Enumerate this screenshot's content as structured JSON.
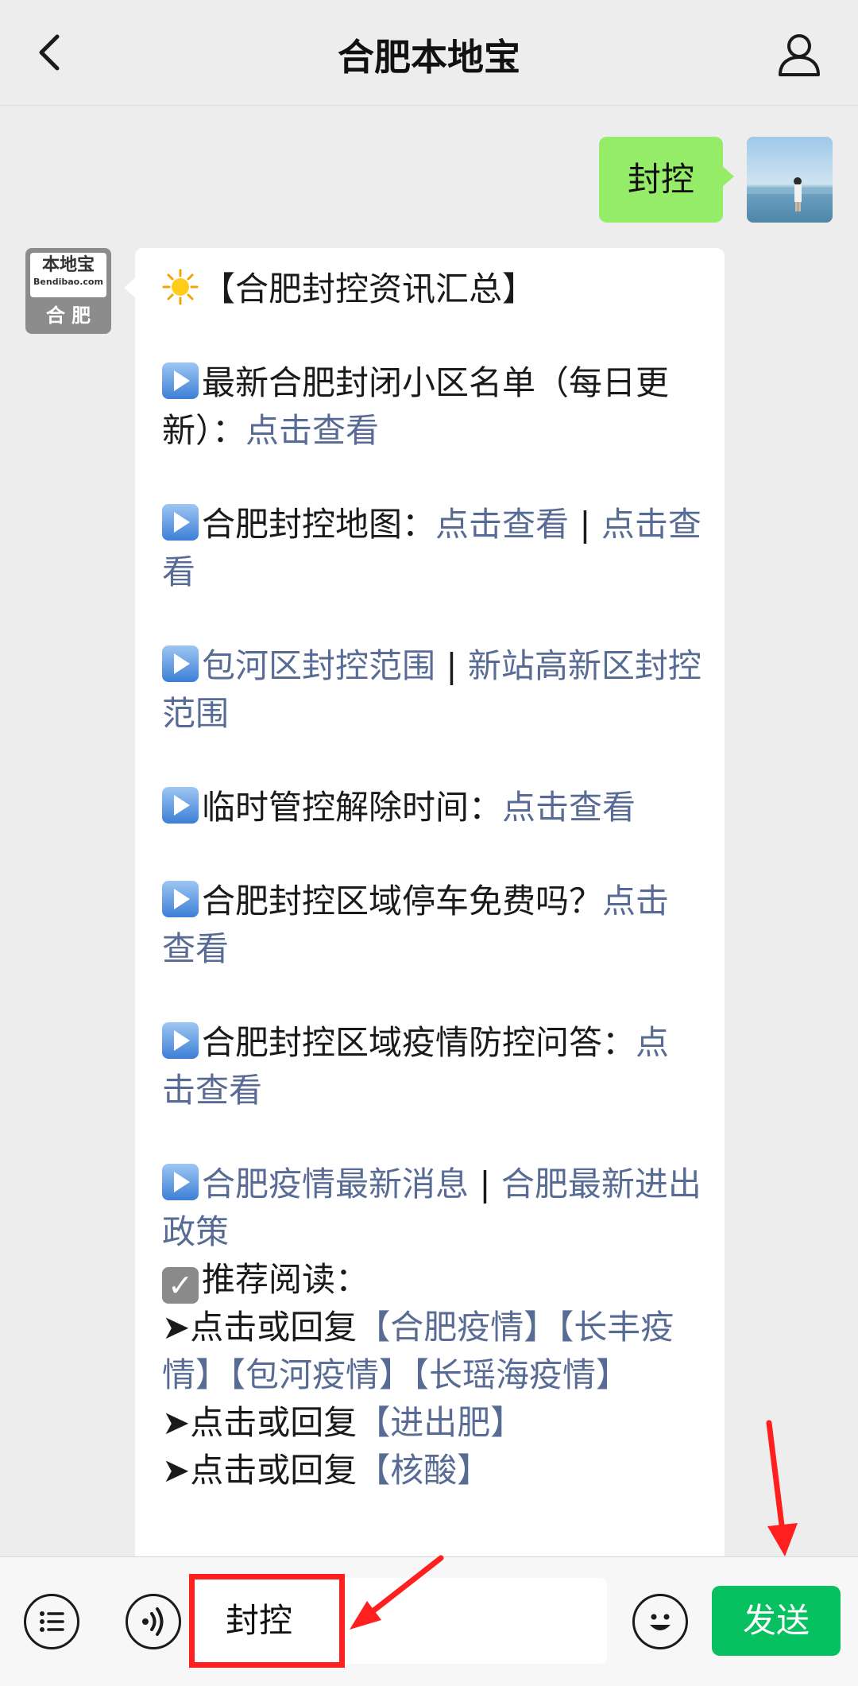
{
  "header": {
    "title": "合肥本地宝"
  },
  "sent_message": {
    "text": "封控"
  },
  "bot_avatar": {
    "brand": "本地宝",
    "url": "Bendibao.com",
    "city": "合 肥"
  },
  "message": {
    "title": "【合肥封控资讯汇总】",
    "items": [
      {
        "text": "最新合肥封闭小区名单（每日更新）：",
        "link": "点击查看"
      },
      {
        "text": "合肥封控地图：",
        "link1": "点击查看",
        "sep": " | ",
        "link2": "点击查看"
      },
      {
        "link1": "包河区封控范围",
        "sep": " | ",
        "link2": "新站高新区封控范围"
      },
      {
        "text": "临时管控解除时间：",
        "link": "点击查看"
      },
      {
        "text": "合肥封控区域停车免费吗？",
        "link": "点击查看"
      },
      {
        "text": "合肥封控区域疫情防控问答：",
        "link": "点击查看"
      },
      {
        "link1": "合肥疫情最新消息",
        "sep": " | ",
        "link2": "合肥最新进出政策"
      }
    ],
    "recommend_label": "推荐阅读：",
    "recommend": [
      {
        "prefix": "➤点击或回复",
        "links": [
          "【合肥疫情】",
          "【长丰疫情】",
          "【包河疫情】",
          "【长瑶海疫情】"
        ]
      },
      {
        "prefix": "➤点击或回复",
        "links": [
          "【进出肥】"
        ]
      },
      {
        "prefix": "➤点击或回复",
        "links": [
          "【核酸】"
        ]
      }
    ]
  },
  "input_bar": {
    "value": "封控",
    "send_label": "发送"
  },
  "colors": {
    "link": "#576b95",
    "sent_bubble": "#95ec69",
    "send_button": "#07c160",
    "annotation": "#ff1f1f"
  },
  "icons": [
    "back-icon",
    "profile-icon",
    "sun-icon",
    "play-icon",
    "check-icon",
    "menu-icon",
    "voice-icon",
    "emoji-icon"
  ]
}
